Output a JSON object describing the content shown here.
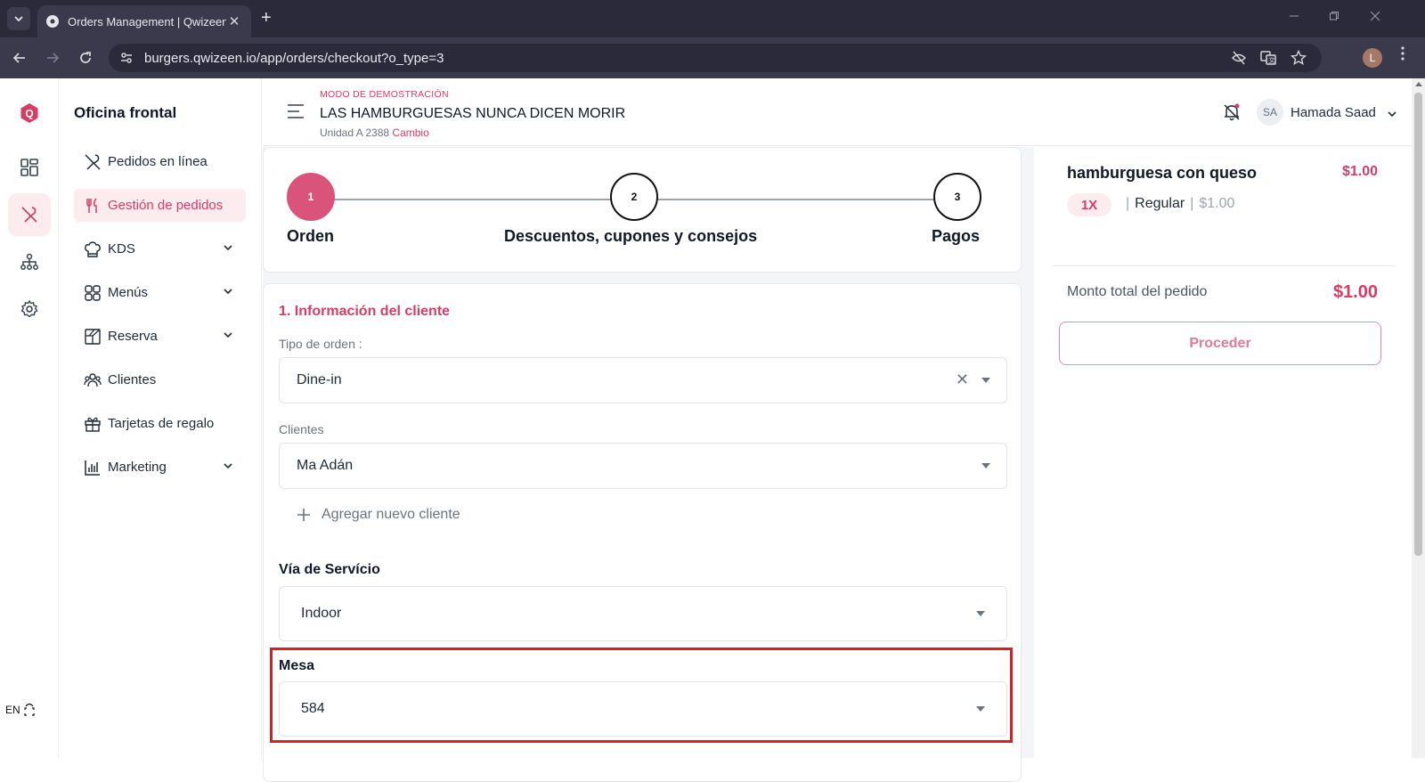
{
  "browser": {
    "tab_title": "Orders Management | Qwizeen",
    "url": "burgers.qwizeen.io/app/orders/checkout?o_type=3",
    "profile_initial": "L",
    "new_tab": "+",
    "tab_close": "✕"
  },
  "rail": {
    "logo_letter": "Q",
    "lang": "EN"
  },
  "sidenav": {
    "title": "Oficina frontal",
    "items": [
      {
        "label": "Pedidos en línea",
        "icon": "utensils-crossed-icon"
      },
      {
        "label": "Gestión de pedidos",
        "icon": "fork-knife-icon",
        "active": true
      },
      {
        "label": "KDS",
        "icon": "chef-hat-icon",
        "expandable": true
      },
      {
        "label": "Menús",
        "icon": "grid-icon",
        "expandable": true
      },
      {
        "label": "Reserva",
        "icon": "table-layout-icon",
        "expandable": true
      },
      {
        "label": "Clientes",
        "icon": "users-icon"
      },
      {
        "label": "Tarjetas de regalo",
        "icon": "gift-icon"
      },
      {
        "label": "Marketing",
        "icon": "bar-chart-icon",
        "expandable": true
      }
    ]
  },
  "topbar": {
    "demo_mode": "MODO DE DEMOSTRACIÓN",
    "restaurant": "LAS HAMBURGUESAS NUNCA DICEN MORIR",
    "unit": "Unidad A 2388",
    "change_link": "Cambio",
    "user_initials": "SA",
    "user_name": "Hamada Saad"
  },
  "stepper": {
    "steps": [
      {
        "number": "1",
        "label": "Orden",
        "active": true
      },
      {
        "number": "2",
        "label": "Descuentos, cupones y consejos"
      },
      {
        "number": "3",
        "label": "Pagos"
      }
    ]
  },
  "customer_info": {
    "title": "1. Información del cliente",
    "order_type_label": "Tipo de orden :",
    "order_type_value": "Dine-in",
    "clients_label": "Clientes",
    "clients_value": "Ma Adán",
    "add_client": "Agregar nuevo cliente",
    "service_label": "Vía de Servício",
    "service_value": "Indoor",
    "table_label": "Mesa",
    "table_value": "584"
  },
  "cart": {
    "item_name": "hamburguesa con queso",
    "item_price": "$1.00",
    "qty": "1X",
    "variant": "Regular",
    "unit_price": "$1.00",
    "total_label": "Monto total del pedido",
    "total_value": "$1.00",
    "proceed": "Proceder"
  },
  "colors": {
    "brand": "#d83c63",
    "highlight_box": "#d61f26"
  }
}
